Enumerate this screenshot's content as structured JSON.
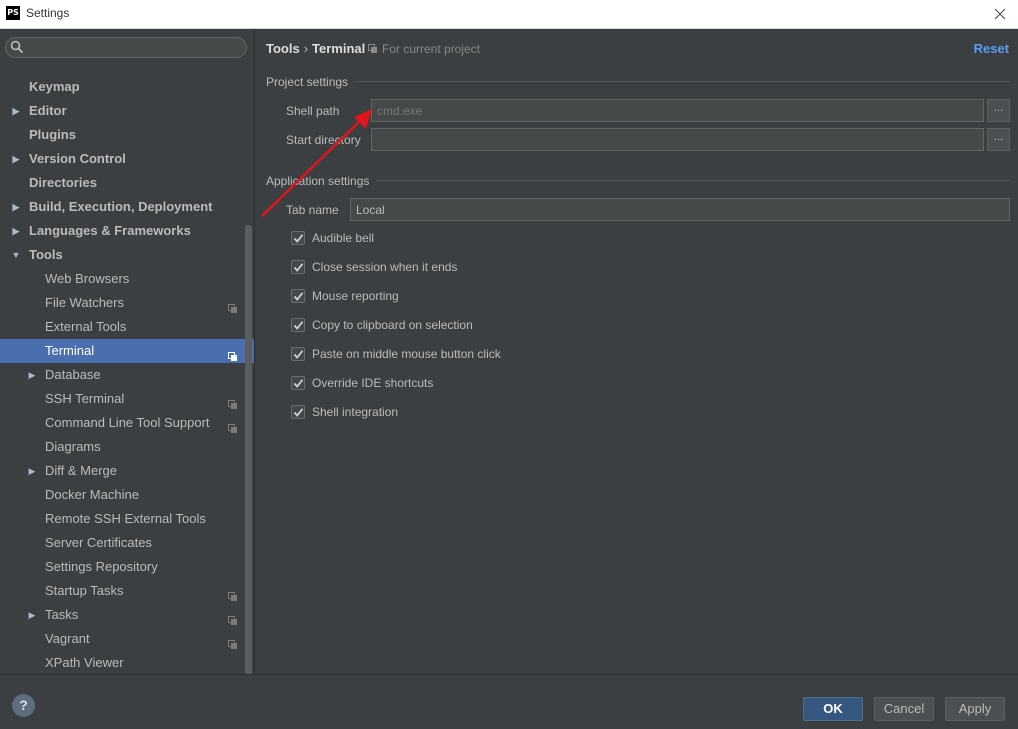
{
  "window": {
    "title": "Settings",
    "app_icon_text": "PS"
  },
  "sidebar": {
    "search_placeholder": "",
    "items": [
      {
        "label": "Keymap",
        "level": 0,
        "bold": true,
        "arrow": ""
      },
      {
        "label": "Editor",
        "level": 0,
        "bold": true,
        "arrow": "right"
      },
      {
        "label": "Plugins",
        "level": 0,
        "bold": true,
        "arrow": ""
      },
      {
        "label": "Version Control",
        "level": 0,
        "bold": true,
        "arrow": "right"
      },
      {
        "label": "Directories",
        "level": 0,
        "bold": true,
        "arrow": ""
      },
      {
        "label": "Build, Execution, Deployment",
        "level": 0,
        "bold": true,
        "arrow": "right"
      },
      {
        "label": "Languages & Frameworks",
        "level": 0,
        "bold": true,
        "arrow": "right"
      },
      {
        "label": "Tools",
        "level": 0,
        "bold": true,
        "arrow": "down"
      },
      {
        "label": "Web Browsers",
        "level": 1,
        "bold": false,
        "arrow": ""
      },
      {
        "label": "File Watchers",
        "level": 1,
        "bold": false,
        "arrow": "",
        "project": true
      },
      {
        "label": "External Tools",
        "level": 1,
        "bold": false,
        "arrow": ""
      },
      {
        "label": "Terminal",
        "level": 1,
        "bold": false,
        "arrow": "",
        "project": true,
        "selected": true
      },
      {
        "label": "Database",
        "level": 1,
        "bold": false,
        "arrow": "right"
      },
      {
        "label": "SSH Terminal",
        "level": 1,
        "bold": false,
        "arrow": "",
        "project": true
      },
      {
        "label": "Command Line Tool Support",
        "level": 1,
        "bold": false,
        "arrow": "",
        "project": true
      },
      {
        "label": "Diagrams",
        "level": 1,
        "bold": false,
        "arrow": ""
      },
      {
        "label": "Diff & Merge",
        "level": 1,
        "bold": false,
        "arrow": "right"
      },
      {
        "label": "Docker Machine",
        "level": 1,
        "bold": false,
        "arrow": ""
      },
      {
        "label": "Remote SSH External Tools",
        "level": 1,
        "bold": false,
        "arrow": ""
      },
      {
        "label": "Server Certificates",
        "level": 1,
        "bold": false,
        "arrow": ""
      },
      {
        "label": "Settings Repository",
        "level": 1,
        "bold": false,
        "arrow": ""
      },
      {
        "label": "Startup Tasks",
        "level": 1,
        "bold": false,
        "arrow": "",
        "project": true
      },
      {
        "label": "Tasks",
        "level": 1,
        "bold": false,
        "arrow": "right",
        "project": true
      },
      {
        "label": "Vagrant",
        "level": 1,
        "bold": false,
        "arrow": "",
        "project": true
      },
      {
        "label": "XPath Viewer",
        "level": 1,
        "bold": false,
        "arrow": ""
      }
    ]
  },
  "main": {
    "breadcrumb": {
      "parent": "Tools",
      "separator": "›",
      "current": "Terminal"
    },
    "scope_note": "For current project",
    "reset_label": "Reset",
    "project_settings": {
      "title": "Project settings",
      "shell_path_label": "Shell path",
      "shell_path_placeholder": "cmd.exe",
      "start_directory_label": "Start directory",
      "start_directory_value": "",
      "browse_label": "..."
    },
    "application_settings": {
      "title": "Application settings",
      "tab_name_label": "Tab name",
      "tab_name_value": "Local",
      "checkboxes": [
        {
          "label": "Audible bell",
          "checked": true
        },
        {
          "label": "Close session when it ends",
          "checked": true
        },
        {
          "label": "Mouse reporting",
          "checked": true
        },
        {
          "label": "Copy to clipboard on selection",
          "checked": true
        },
        {
          "label": "Paste on middle mouse button click",
          "checked": true
        },
        {
          "label": "Override IDE shortcuts",
          "checked": true
        },
        {
          "label": "Shell integration",
          "checked": true
        }
      ]
    }
  },
  "footer": {
    "help_label": "?",
    "ok_label": "OK",
    "cancel_label": "Cancel",
    "apply_label": "Apply"
  },
  "colors": {
    "background": "#3c3f41",
    "selection": "#4b6eaf",
    "link": "#589df6",
    "primary_button": "#365880",
    "annotation_arrow": "#e0151b"
  }
}
